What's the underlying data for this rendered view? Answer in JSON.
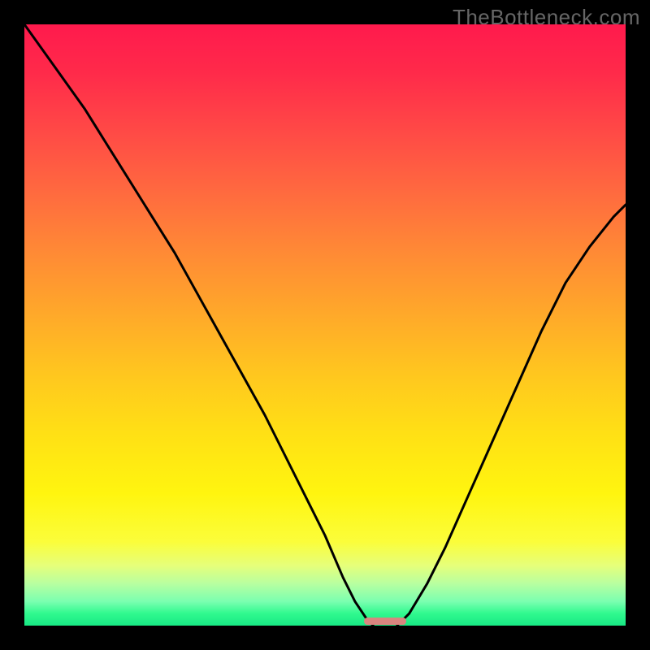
{
  "watermark": "TheBottleneck.com",
  "colors": {
    "background": "#000000",
    "gradient_top": "#ff1a4d",
    "gradient_bottom": "#18e884",
    "marker": "#d9857f",
    "curve": "#000000"
  },
  "chart_data": {
    "type": "line",
    "title": "",
    "xlabel": "",
    "ylabel": "",
    "xlim": [
      0,
      100
    ],
    "ylim": [
      0,
      100
    ],
    "grid": false,
    "series": [
      {
        "name": "left-branch",
        "x": [
          0,
          5,
          10,
          15,
          20,
          25,
          30,
          35,
          40,
          45,
          50,
          53,
          55,
          57,
          58
        ],
        "y": [
          100,
          93,
          86,
          78,
          70,
          62,
          53,
          44,
          35,
          25,
          15,
          8,
          4,
          1,
          0
        ]
      },
      {
        "name": "right-branch",
        "x": [
          62,
          64,
          67,
          70,
          74,
          78,
          82,
          86,
          90,
          94,
          98,
          100
        ],
        "y": [
          0,
          2,
          7,
          13,
          22,
          31,
          40,
          49,
          57,
          63,
          68,
          70
        ]
      }
    ],
    "marker": {
      "x_center": 60,
      "width": 7,
      "height": 1.2
    }
  }
}
